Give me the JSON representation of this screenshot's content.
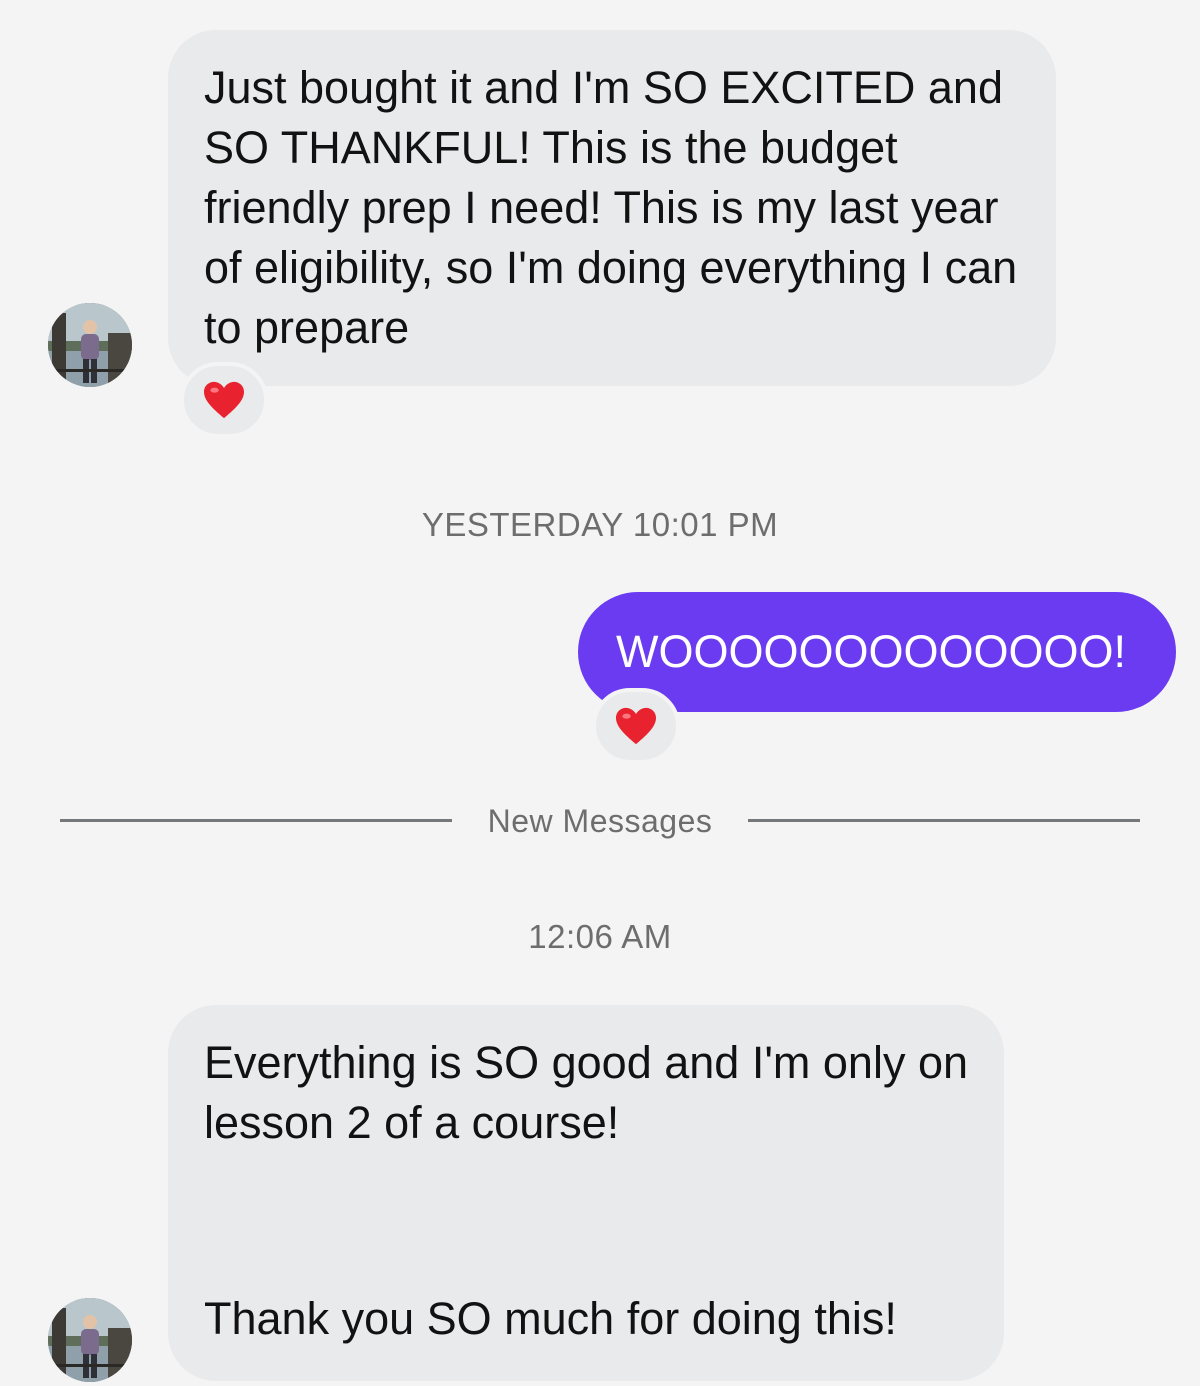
{
  "messages": [
    {
      "direction": "incoming",
      "text": "Just bought it and I'm SO EXCITED and SO THANKFUL! This is the budget friendly prep I need! This is my last year of eligibility, so I'm doing everything I can to prepare",
      "reaction": "heart-emoji"
    },
    {
      "direction": "outgoing",
      "text": "WOOOOOOOOOOOOO!",
      "reaction": "heart-emoji"
    },
    {
      "direction": "incoming",
      "paragraphs": [
        "Everything is SO good and I'm only on lesson 2 of a course!",
        "Thank you SO much for doing this!"
      ]
    }
  ],
  "timestamps": {
    "first": "YESTERDAY 10:01 PM",
    "second": "12:06 AM"
  },
  "new_messages_label": "New Messages",
  "colors": {
    "background": "#f4f4f4",
    "incoming_bubble": "#e9eaec",
    "outgoing_bubble": "#6b3bf2",
    "heart": "#e8222e"
  }
}
